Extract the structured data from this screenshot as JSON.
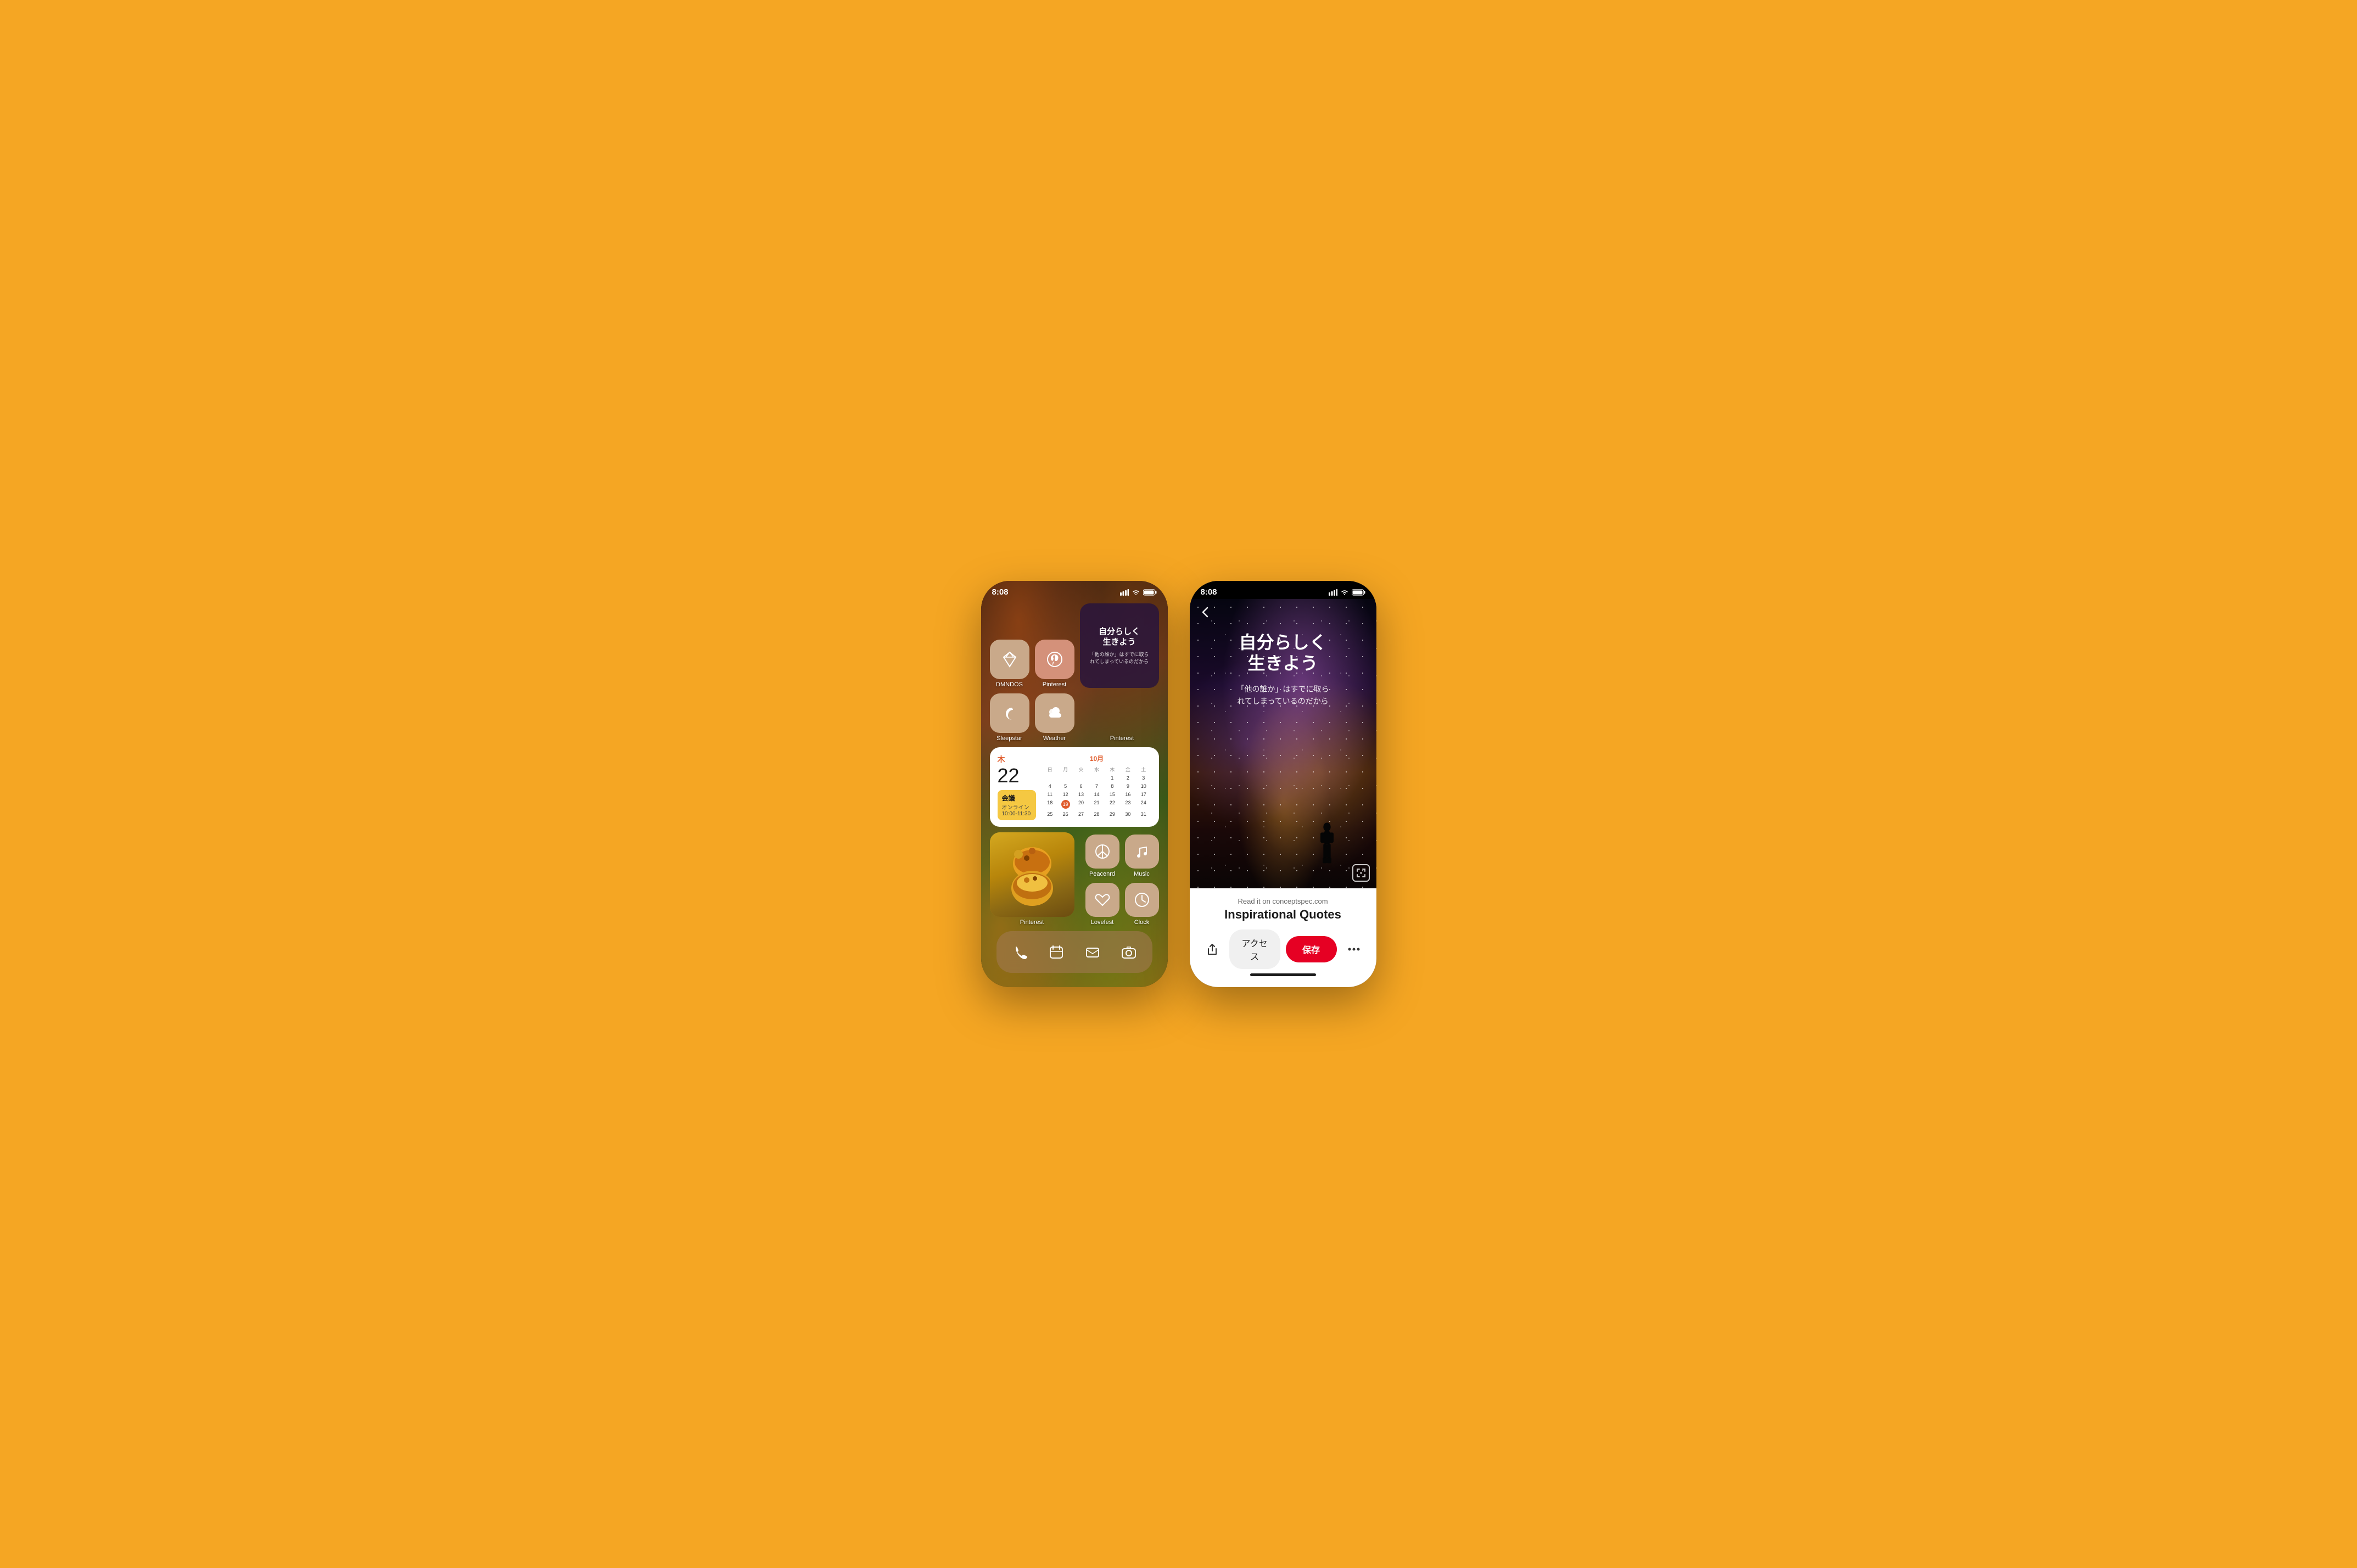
{
  "background_color": "#F5A623",
  "phone1": {
    "status": {
      "time": "8:08",
      "signal": "▂▄▆",
      "wifi": "wifi",
      "battery": "battery"
    },
    "apps_row1": [
      {
        "id": "dmndos",
        "label": "DMNDOS",
        "icon": "diamond",
        "bg": "#c9a98a"
      },
      {
        "id": "pinterest",
        "label": "Pinterest",
        "icon": "pinterest",
        "bg": "#d4917a"
      }
    ],
    "quote_widget": {
      "main": "自分らしく\n生きよう",
      "sub": "「他の誰か」はすでに取ら\nれてしまっているのだから",
      "label": "Pinterest"
    },
    "apps_row2": [
      {
        "id": "sleepstar",
        "label": "Sleepstar",
        "icon": "moon",
        "bg": "#c9a98a"
      },
      {
        "id": "weather",
        "label": "Weather",
        "icon": "cloud",
        "bg": "#c9a98a"
      }
    ],
    "calendar": {
      "day_label": "木",
      "day_num": "22",
      "month_label": "10月",
      "event_title": "会議",
      "event_location": "オンライン",
      "event_time": "10:00-11:30",
      "headers": [
        "日",
        "月",
        "火",
        "水",
        "木",
        "金",
        "土"
      ],
      "weeks": [
        [
          "",
          "",
          "",
          "",
          "1",
          "2",
          "3"
        ],
        [
          "4",
          "5",
          "6",
          "7",
          "8",
          "9",
          "10"
        ],
        [
          "11",
          "12",
          "13",
          "14",
          "15",
          "16",
          "17"
        ],
        [
          "18",
          "19",
          "20",
          "21",
          "22",
          "23",
          "24"
        ],
        [
          "25",
          "26",
          "27",
          "28",
          "29",
          "30",
          "31"
        ]
      ],
      "today": "19"
    },
    "apps_bottom": [
      {
        "id": "peacenrd",
        "label": "Peacenrd",
        "icon": "peace",
        "bg": "#c9a98a"
      },
      {
        "id": "music",
        "label": "Music",
        "icon": "music",
        "bg": "#c9a98a"
      },
      {
        "id": "lovefest",
        "label": "Lovefest",
        "icon": "heart",
        "bg": "#c9a98a"
      },
      {
        "id": "clock",
        "label": "Clock",
        "icon": "clock",
        "bg": "#c9a98a"
      }
    ],
    "dock": [
      {
        "id": "phone",
        "icon": "phone"
      },
      {
        "id": "calendar",
        "icon": "calendar"
      },
      {
        "id": "mail",
        "icon": "mail"
      },
      {
        "id": "camera",
        "icon": "camera"
      }
    ],
    "pinterest_label": "Pinterest"
  },
  "phone2": {
    "status": {
      "time": "8:08"
    },
    "quote_main": "自分らしく\n生きよう",
    "quote_sub": "「他の誰か」はすでに取ら\nれてしまっているのだから",
    "read_it_on": "Read it on",
    "website": "conceptspec.com",
    "pin_title": "Inspirational Quotes",
    "access_label": "アクセス",
    "save_label": "保存",
    "back_label": "‹"
  }
}
